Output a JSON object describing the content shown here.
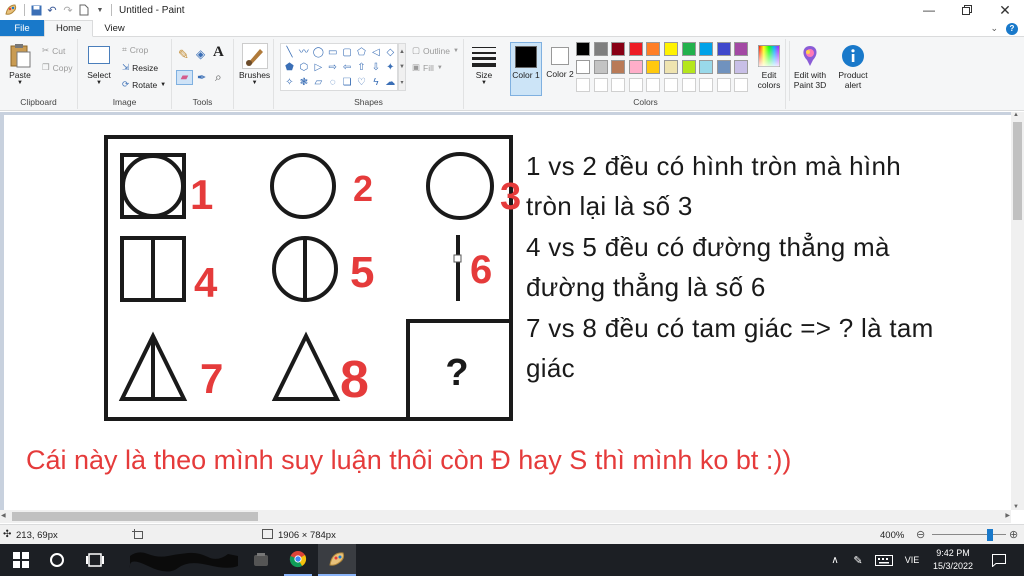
{
  "app": {
    "title": "Untitled - Paint",
    "icon": "paint-app-icon"
  },
  "quick_access": [
    "save-icon",
    "undo-icon",
    "redo-icon",
    "new-file-icon",
    "customize-arrow-icon"
  ],
  "tabs": {
    "file": "File",
    "home": "Home",
    "view": "View"
  },
  "ribbon": {
    "clipboard": {
      "label": "Clipboard",
      "paste": "Paste",
      "cut": "Cut",
      "copy": "Copy"
    },
    "image": {
      "label": "Image",
      "select": "Select",
      "crop": "Crop",
      "resize": "Resize",
      "rotate": "Rotate"
    },
    "tools": {
      "label": "Tools"
    },
    "brushes": {
      "label": "Brushes"
    },
    "shapes": {
      "label": "Shapes",
      "outline": "Outline",
      "fill": "Fill"
    },
    "size": {
      "label": "Size"
    },
    "colors": {
      "label": "Colors",
      "color1": "Color 1",
      "color2": "Color 2",
      "edit_colors": "Edit colors",
      "edit_3d": "Edit with Paint 3D",
      "product_alert": "Product alert",
      "color1_value": "#000000",
      "color2_value": "#ffffff",
      "palette_row1": [
        "#000000",
        "#7f7f7f",
        "#880015",
        "#ed1c24",
        "#ff7f27",
        "#fff200",
        "#22b14c",
        "#00a2e8",
        "#3f48cc",
        "#a349a4"
      ],
      "palette_row2": [
        "#ffffff",
        "#c3c3c3",
        "#b97a57",
        "#ffaec9",
        "#ffc90e",
        "#efe4b0",
        "#b5e61d",
        "#99d9ea",
        "#7092be",
        "#c8bfe7"
      ]
    }
  },
  "canvas": {
    "puzzle_numbers": [
      "1",
      "2",
      "3",
      "4",
      "5",
      "6",
      "7",
      "8"
    ],
    "question_mark": "?",
    "notes": [
      " 1 vs 2 đều có hình tròn mà hình",
      "tròn lại là số 3",
      "4 vs 5 đều có đường thẳng mà",
      "đường thẳng là số 6",
      "7 vs 8 đều có tam giác => ? là tam",
      "giác"
    ],
    "footer_note": "Cái này là theo mình suy luận thôi còn Đ hay S thì mình ko bt :))"
  },
  "status": {
    "cursor_pos": "213, 69px",
    "image_size": "1906 × 784px",
    "zoom": "400%",
    "zoom_level": 0.78
  },
  "taskbar": {
    "language": "VIE",
    "time": "9:42 PM",
    "date": "15/3/2022"
  }
}
